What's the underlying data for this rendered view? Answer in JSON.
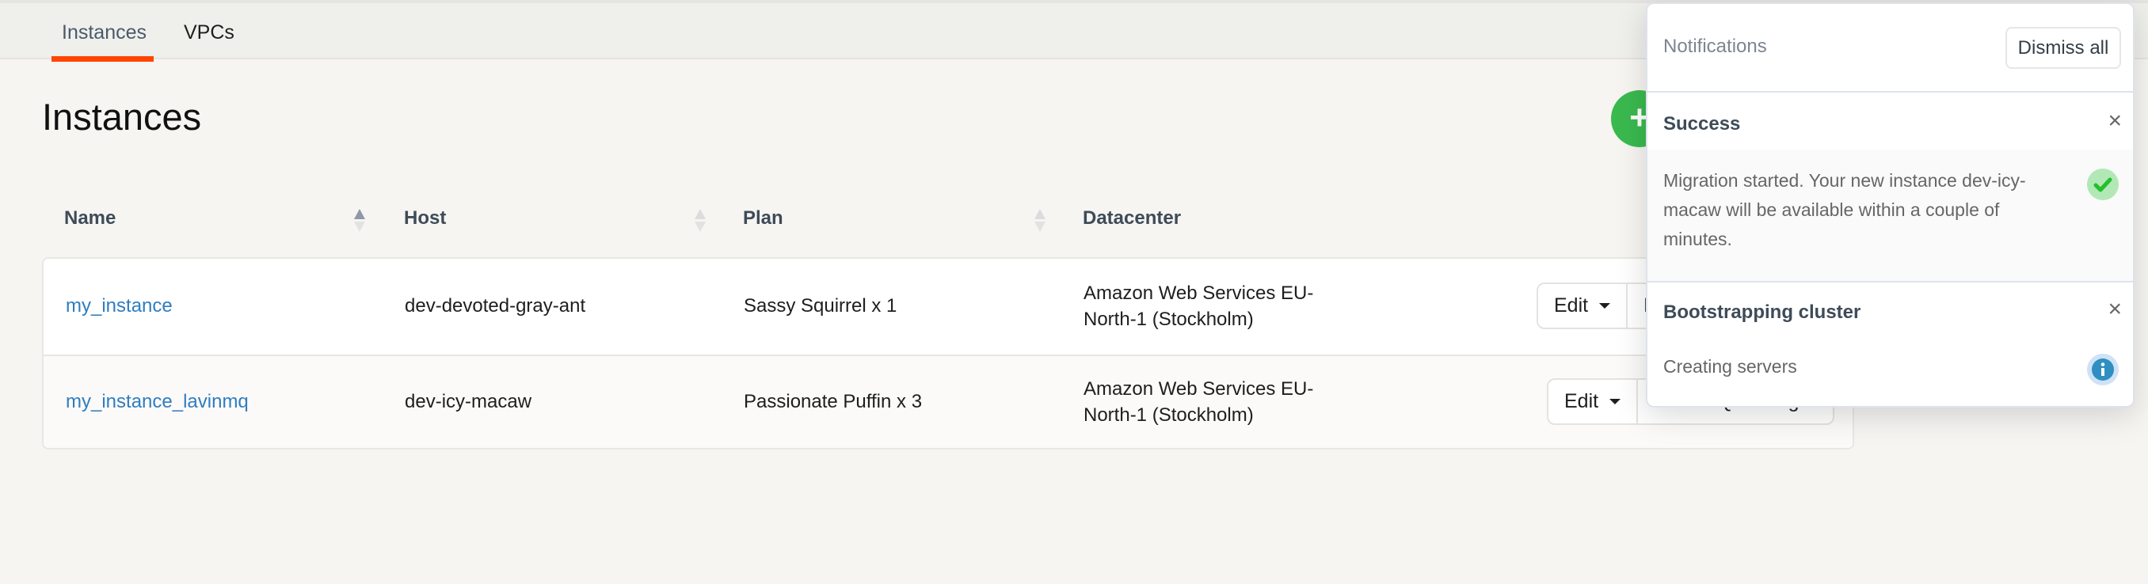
{
  "tabs": [
    {
      "label": "Instances",
      "active": true
    },
    {
      "label": "VPCs",
      "active": false
    }
  ],
  "page": {
    "title": "Instances",
    "add_button_icon": "plus-icon",
    "add_button_label": "+"
  },
  "table": {
    "columns": [
      {
        "label": "Name",
        "sortable": true,
        "sort": "asc"
      },
      {
        "label": "Host",
        "sortable": true,
        "sort": "none"
      },
      {
        "label": "Plan",
        "sortable": true,
        "sort": "none"
      },
      {
        "label": "Datacenter",
        "sortable": false
      }
    ],
    "rows": [
      {
        "name": "my_instance",
        "host": "dev-devoted-gray-ant",
        "plan": "Sassy Squirrel x 1",
        "datacenter": "Amazon Web Services EU-North-1 (Stockholm)",
        "actions": {
          "edit": "Edit",
          "manager": "RabbitMQ manager"
        }
      },
      {
        "name": "my_instance_lavinmq",
        "host": "dev-icy-macaw",
        "plan": "Passionate Puffin x 3",
        "datacenter": "Amazon Web Services EU-North-1 (Stockholm)",
        "actions": {
          "edit": "Edit",
          "manager": "LavinMQ manager"
        }
      }
    ]
  },
  "notifications": {
    "title": "Notifications",
    "dismiss_all": "Dismiss all",
    "items": [
      {
        "title": "Success",
        "message": "Migration started. Your new instance dev-icy-macaw will be available within a couple of minutes.",
        "icon": "check-icon",
        "color": "#2ecc40"
      },
      {
        "title": "Bootstrapping cluster",
        "message": "Creating servers",
        "icon": "info-icon",
        "color": "#2f8fc0"
      }
    ],
    "close_label": "×"
  },
  "colors": {
    "accent": "#ff4500",
    "primary_green": "#3ab94f",
    "link": "#2f7dc0"
  }
}
